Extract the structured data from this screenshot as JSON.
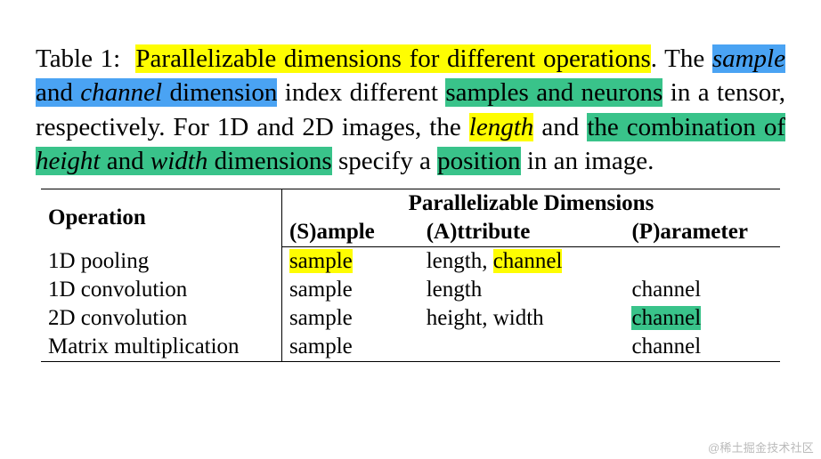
{
  "caption": {
    "label": "Table 1:",
    "title": "Parallelizable dimensions for different operations",
    "t1": ". The ",
    "hl_sample": "sample",
    "t2": " and ",
    "hl_channel": "channel",
    "hl_dim": " dimension",
    "t3": " index different ",
    "hl_sn": "samples and neurons",
    "t4": " in a tensor, respectively. For 1D and 2D images, the ",
    "hl_length": "length",
    "t5": " and ",
    "hl_combo1": "the combination of ",
    "hl_height": "height",
    "hl_combo2": " and ",
    "hl_width": "width",
    "hl_combo3": " dimensions",
    "t6": " specify a ",
    "hl_position": "position",
    "t7": " in an image."
  },
  "table": {
    "hdr_operation": "Operation",
    "hdr_pd": "Parallelizable Dimensions",
    "hdr_sample": "(S)ample",
    "hdr_attribute": "(A)ttribute",
    "hdr_parameter": "(P)arameter",
    "rows": [
      {
        "op": "1D pooling",
        "sample": "sample",
        "sample_hl": "y",
        "attr_pre": "length, ",
        "attr_hl": "channel",
        "attr_hl_cls": "y",
        "param": ""
      },
      {
        "op": "1D convolution",
        "sample": "sample",
        "sample_hl": "",
        "attr_pre": "length",
        "attr_hl": "",
        "attr_hl_cls": "",
        "param": "channel"
      },
      {
        "op": "2D convolution",
        "sample": "sample",
        "sample_hl": "",
        "attr_pre": "height, width",
        "attr_hl": "",
        "attr_hl_cls": "",
        "param": "channel",
        "param_hl": "g"
      },
      {
        "op": "Matrix multiplication",
        "sample": "sample",
        "sample_hl": "",
        "attr_pre": "",
        "attr_hl": "",
        "attr_hl_cls": "",
        "param": "channel"
      }
    ]
  },
  "watermark": "@稀土掘金技术社区"
}
